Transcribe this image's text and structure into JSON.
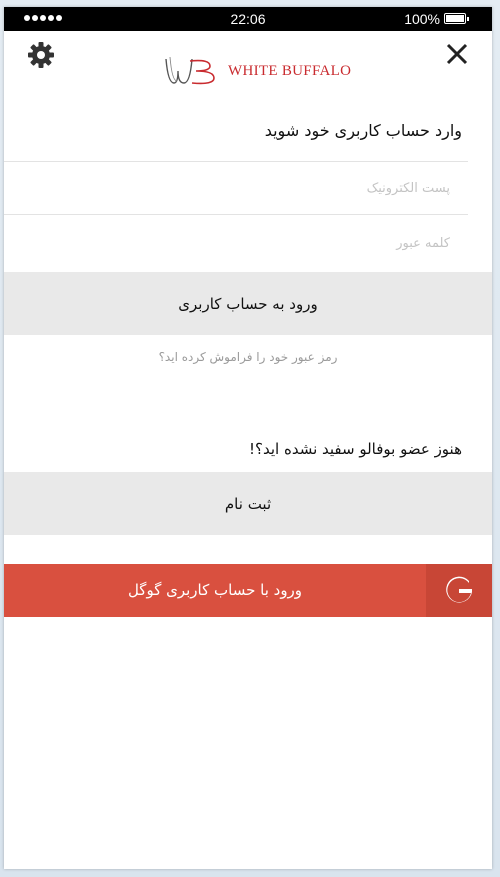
{
  "status_bar": {
    "time": "22:06",
    "battery": "100%"
  },
  "header": {
    "logo_text": "WHITE BUFFALO",
    "settings_icon": "gear-icon",
    "close_icon": "close-icon",
    "close_label": "X"
  },
  "form": {
    "title": "وارد حساب کاربری خود شوید",
    "email_placeholder": "پست الکترونیک",
    "email_value": "",
    "password_placeholder": "کلمه عبور",
    "password_value": "",
    "login_button": "ورود به حساب کاربری",
    "forgot_password": "رمز عبور خود را فراموش کرده اید؟"
  },
  "register": {
    "prompt": "هنوز عضو بوفالو سفید نشده اید؟!",
    "button": "ثبت نام"
  },
  "google": {
    "button": "ورود با حساب کاربری گوگل",
    "icon": "google-g-icon"
  },
  "colors": {
    "brand_red": "#c92b2f",
    "google_button": "#d9503f",
    "google_icon_bg": "#c84636",
    "gray_button": "#e9e9e9"
  }
}
